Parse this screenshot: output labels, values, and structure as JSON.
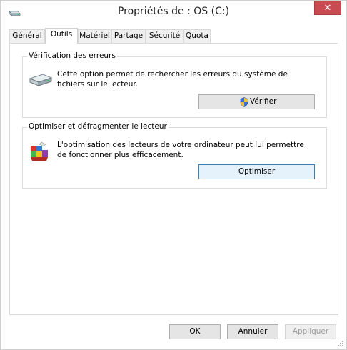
{
  "window": {
    "title": "Propriétés de : OS (C:)",
    "close_glyph": "✕",
    "title_icon": "drive-icon",
    "accent_color": "#c74b50"
  },
  "tabs": [
    {
      "label": "Général",
      "active": false
    },
    {
      "label": "Outils",
      "active": true
    },
    {
      "label": "Matériel",
      "active": false
    },
    {
      "label": "Partage",
      "active": false
    },
    {
      "label": "Sécurité",
      "active": false
    },
    {
      "label": "Quota",
      "active": false
    }
  ],
  "error_check": {
    "group_label": "Vérification des erreurs",
    "description": "Cette option permet de rechercher les erreurs du système de fichiers sur le lecteur.",
    "icon": "hard-drive-icon",
    "button_label": "Vérifier",
    "button_icon": "uac-shield-icon"
  },
  "optimize": {
    "group_label": "Optimiser et défragmenter le lecteur",
    "description": "L'optimisation des lecteurs de votre ordinateur peut lui permettre de fonctionner plus efficacement.",
    "icon": "defrag-icon",
    "button_label": "Optimiser"
  },
  "footer": {
    "ok_label": "OK",
    "cancel_label": "Annuler",
    "apply_label": "Appliquer"
  }
}
